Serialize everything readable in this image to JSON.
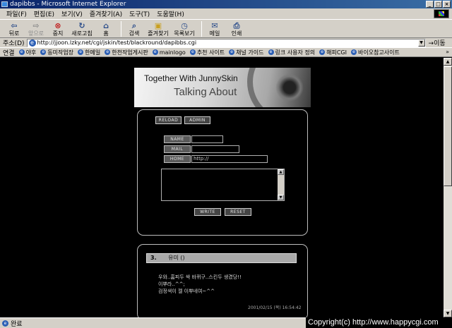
{
  "window": {
    "title": "dapibbs - Microsoft Internet Explorer",
    "btn_minimize": "_",
    "btn_maximize": "□",
    "btn_close": "×"
  },
  "menu": [
    "파일(F)",
    "편집(E)",
    "보기(V)",
    "즐겨찾기(A)",
    "도구(T)",
    "도움말(H)"
  ],
  "toolbar": {
    "back": "뒤로",
    "forward": "앞으로",
    "stop": "중지",
    "refresh": "새로고침",
    "home": "홈",
    "search": "검색",
    "favorites": "즐겨찾기",
    "history": "목록보기",
    "mail": "메일",
    "print": "인쇄"
  },
  "address": {
    "label": "주소(D)",
    "url": "http://jjoon.lzky.net/cgi/jskin/test/blackround/dapibbs.cgi",
    "go": "이동"
  },
  "links": {
    "label": "연결",
    "items": [
      "야후",
      "동미작업장",
      "한메일",
      "한천작업게시판",
      "mainlogo",
      "추천 사이트",
      "채널 가이드",
      "링크 사용자 정의",
      "해피CGI",
      "바이오참고사이트"
    ],
    "more": "»"
  },
  "banner": {
    "line1": "Together With JunnySkin",
    "line2": "Talking About"
  },
  "form": {
    "reload": "RELOAD",
    "admin": "ADMIN",
    "name_label": "NAME",
    "mail_label": "MAIL",
    "home_label": "HOME",
    "name_value": "",
    "mail_value": "",
    "home_value": "http://",
    "write": "WRITE",
    "reset": "RESET"
  },
  "post": {
    "number": "3.",
    "author": "유미 ()",
    "lines": [
      "우와..홈피두 싹 바뀌구..스킨두 생겼당!!",
      "이뿌라..^^;",
      "검정색이 젤 이뿌네여~^^"
    ],
    "timestamp": "2001/02/15 (목) 16:54:42"
  },
  "status": {
    "text": "완료",
    "copyright": "Copyright(c) http://www.happycgi.com"
  }
}
